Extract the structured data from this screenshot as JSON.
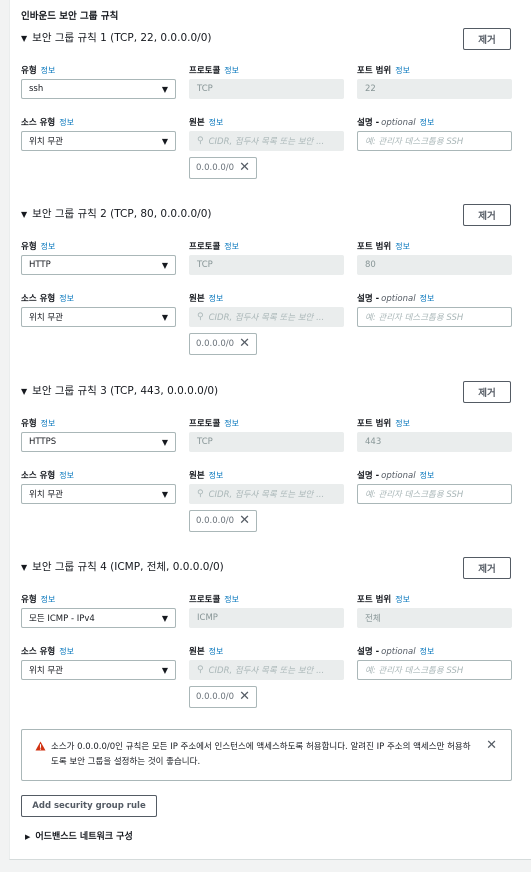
{
  "section_title": "인바운드 보안 그룹 규칙",
  "info_label": "정보",
  "labels": {
    "type": "유형",
    "protocol": "프로토콜",
    "port_range": "포트 범위",
    "source_type": "소스 유형",
    "source": "원본",
    "description": "설명 -",
    "optional": "optional"
  },
  "remove_label": "제거",
  "rules": [
    {
      "title": "보안 그룹 규칙 1 (TCP, 22, 0.0.0.0/0)",
      "type": "ssh",
      "protocol": "TCP",
      "port": "22",
      "source_type": "위치 무관",
      "source_placeholder": "CIDR, 접두사 목록 또는 보안 ...",
      "token": "0.0.0.0/0",
      "desc_placeholder": "예: 관리자 데스크톱용 SSH"
    },
    {
      "title": "보안 그룹 규칙 2 (TCP, 80, 0.0.0.0/0)",
      "type": "HTTP",
      "protocol": "TCP",
      "port": "80",
      "source_type": "위치 무관",
      "source_placeholder": "CIDR, 접두사 목록 또는 보안 ...",
      "token": "0.0.0.0/0",
      "desc_placeholder": "예: 관리자 데스크톱용 SSH"
    },
    {
      "title": "보안 그룹 규칙 3 (TCP, 443, 0.0.0.0/0)",
      "type": "HTTPS",
      "protocol": "TCP",
      "port": "443",
      "source_type": "위치 무관",
      "source_placeholder": "CIDR, 접두사 목록 또는 보안 ...",
      "token": "0.0.0.0/0",
      "desc_placeholder": "예: 관리자 데스크톱용 SSH"
    },
    {
      "title": "보안 그룹 규칙 4 (ICMP, 전체, 0.0.0.0/0)",
      "type": "모든 ICMP - IPv4",
      "protocol": "ICMP",
      "port": "전체",
      "source_type": "위치 무관",
      "source_placeholder": "CIDR, 접두사 목록 또는 보안 ...",
      "token": "0.0.0.0/0",
      "desc_placeholder": "예: 관리자 데스크톱용 SSH"
    }
  ],
  "alert": {
    "message": "소스가 0.0.0.0/0인 규칙은 모든 IP 주소에서 인스턴스에 액세스하도록 허용합니다. 알려진 IP 주소의 액세스만 허용하도록 보안 그룹을 설정하는 것이 좋습니다.",
    "color": "#d13212"
  },
  "add_rule_label": "Add security group rule",
  "advanced_label": "어드밴스드 네트워크 구성",
  "colors": {
    "info_link": "#0073bb",
    "warning": "#d13212",
    "readonly_bg": "#eaeded"
  }
}
